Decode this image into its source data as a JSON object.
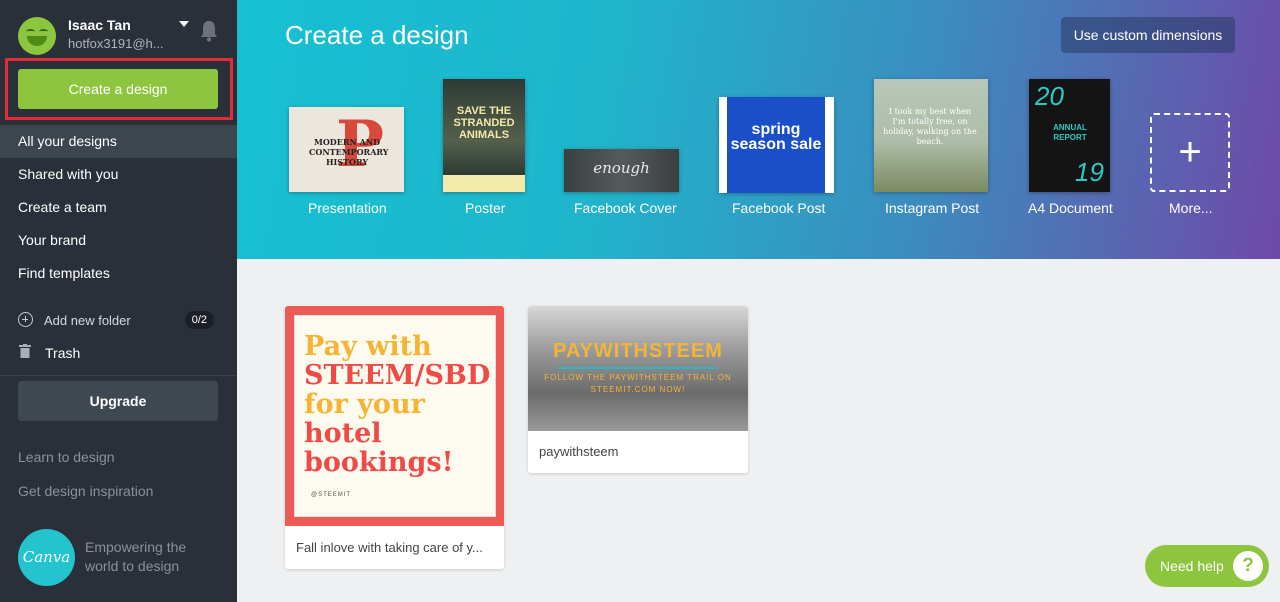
{
  "user": {
    "name": "Isaac Tan",
    "email": "hotfox3191@h..."
  },
  "sidebar": {
    "create_label": "Create a design",
    "nav": [
      {
        "label": "All your designs",
        "active": true
      },
      {
        "label": "Shared with you"
      },
      {
        "label": "Create a team"
      },
      {
        "label": "Your brand"
      },
      {
        "label": "Find templates"
      }
    ],
    "add_folder_label": "Add new folder",
    "folder_count": "0/2",
    "trash_label": "Trash",
    "upgrade_label": "Upgrade",
    "learn_label": "Learn to design",
    "inspiration_label": "Get design inspiration",
    "logo_text": "Canva",
    "tagline": "Empowering the world to design"
  },
  "hero": {
    "title": "Create a design",
    "custom_dimensions_label": "Use custom dimensions",
    "templates": [
      {
        "label": "Presentation",
        "thumb": "MODERN AND CONTEMPORARY HISTORY",
        "mark": "P"
      },
      {
        "label": "Poster",
        "thumb": "SAVE THE STRANDED ANIMALS"
      },
      {
        "label": "Facebook Cover",
        "thumb": "enough"
      },
      {
        "label": "Facebook Post",
        "thumb": "spring season sale"
      },
      {
        "label": "Instagram Post",
        "thumb": "I took my best when I'm totally free, on holiday, walking on the beach."
      },
      {
        "label": "A4 Document",
        "thumb_top": "20",
        "thumb_mid": "ANNUAL REPORT",
        "thumb_bottom": "19"
      },
      {
        "label": "More..."
      }
    ]
  },
  "designs": [
    {
      "caption": "Fall inlove with taking care of y...",
      "thumb_lines": [
        "Pay with",
        "STEEM/SBD",
        "for your",
        "hotel",
        "bookings!"
      ],
      "thumb_footer": "@STEEMIT"
    },
    {
      "caption": "paywithsteem",
      "thumb_title": "PAYWITHSTEEM",
      "thumb_sub": "FOLLOW THE PAYWITHSTEEM TRAIL ON STEEMIT.COM NOW!"
    }
  ],
  "help": {
    "label": "Need help",
    "icon_text": "?"
  },
  "colors": {
    "accent": "#8dc53e",
    "sidebar": "#293039",
    "highlight": "#e32d36"
  }
}
